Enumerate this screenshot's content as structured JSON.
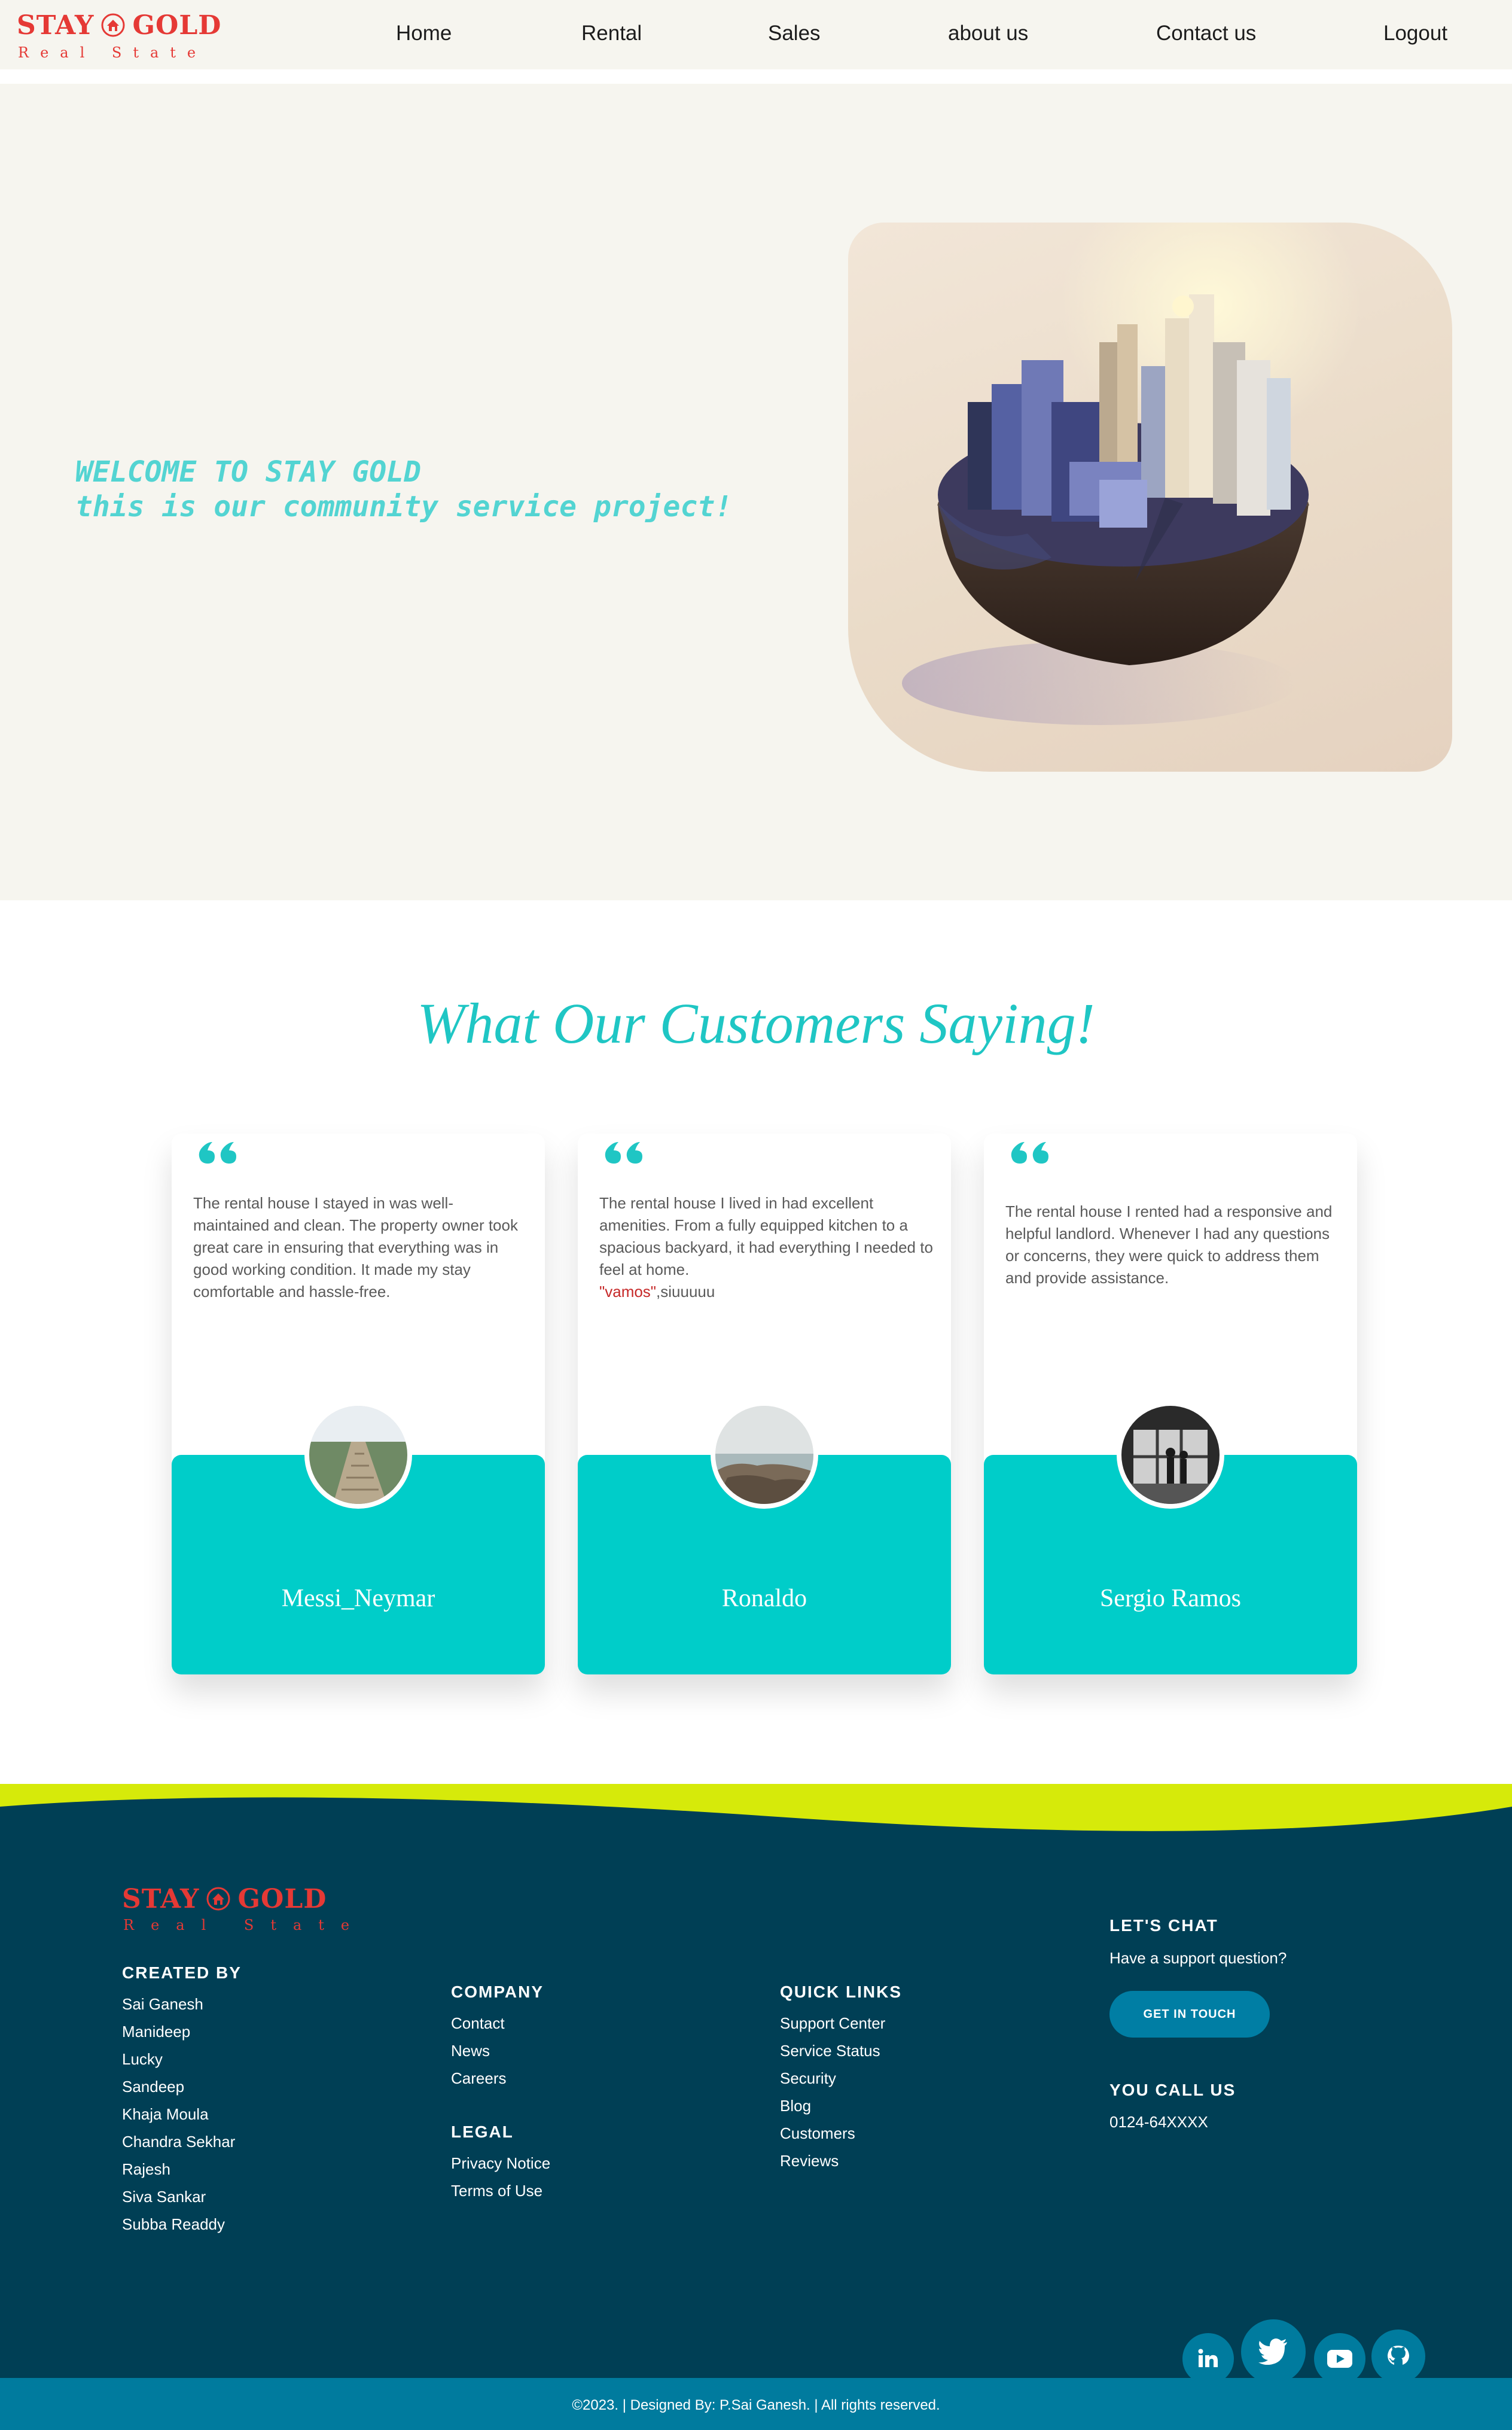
{
  "brand": {
    "name_left": "STAY",
    "name_right": "GOLD",
    "tagline": "Real State",
    "color": "#e53935"
  },
  "nav": {
    "links": [
      "Home",
      "Rental",
      "Sales",
      "about us",
      "Contact us",
      "Logout"
    ]
  },
  "hero": {
    "line1": "WELCOME TO STAY GOLD",
    "line2": "this is our community service project!",
    "image_icon": "city-globe-image"
  },
  "testimonials": {
    "title": "What Our Customers Saying!",
    "cards": [
      {
        "text": "The rental house I stayed in was well-maintained and clean. The property owner took great care in ensuring that everything was in good working condition. It made my stay comfortable and hassle-free.",
        "highlight": "",
        "suffix": "",
        "name": "Messi_Neymar",
        "avatar": "boardwalk-photo"
      },
      {
        "text": "The rental house I lived in had excellent amenities. From a fully equipped kitchen to a spacious backyard, it had everything I needed to feel at home.",
        "highlight": "\"vamos\"",
        "suffix": ",siuuuuu",
        "name": "Ronaldo",
        "avatar": "rocky-shore-photo"
      },
      {
        "text": "The rental house I rented had a responsive and helpful landlord. Whenever I had any questions or concerns, they were quick to address them and provide assistance.",
        "highlight": "",
        "suffix": "",
        "name": "Sergio Ramos",
        "avatar": "window-silhouettes-photo"
      }
    ]
  },
  "footer": {
    "created_by": {
      "heading": "CREATED BY",
      "names": [
        "Sai Ganesh",
        "Manideep",
        "Lucky",
        "Sandeep",
        "Khaja Moula",
        "Chandra Sekhar",
        "Rajesh",
        "Siva Sankar",
        "Subba Readdy"
      ]
    },
    "company": {
      "heading": "COMPANY",
      "links": [
        "Contact",
        "News",
        "Careers"
      ]
    },
    "legal": {
      "heading": "LEGAL",
      "links": [
        "Privacy Notice",
        "Terms of Use"
      ]
    },
    "quick_links": {
      "heading": "QUICK LINKS",
      "links": [
        "Support Center",
        "Service Status",
        "Security",
        "Blog",
        "Customers",
        "Reviews"
      ]
    },
    "chat": {
      "heading": "LET'S CHAT",
      "text": "Have a support question?",
      "button": "GET IN TOUCH"
    },
    "call": {
      "heading": "YOU CALL US",
      "phone": "0124-64XXXX"
    },
    "social_icons": [
      "linkedin-icon",
      "twitter-icon",
      "youtube-icon",
      "github-icon"
    ],
    "copyright": "©2023. | Designed By: P.Sai Ganesh. | All rights reserved.",
    "colors": {
      "background": "#003f55",
      "wave": "#d6ea0a",
      "accent": "#007b9e"
    }
  }
}
